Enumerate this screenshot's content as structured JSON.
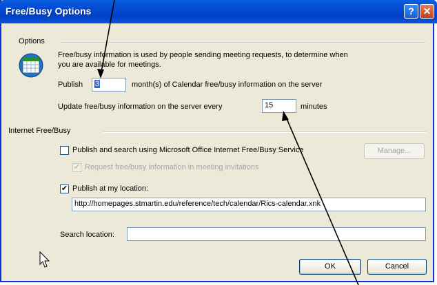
{
  "window": {
    "title": "Free/Busy Options",
    "help_glyph": "?",
    "close_glyph": "✕"
  },
  "options": {
    "group_label": "Options",
    "description_line1": "Free/busy information is used by people sending meeting requests, to determine when",
    "description_line2": "you are available for meetings.",
    "publish_label": "Publish",
    "publish_months_value": "3",
    "publish_suffix": "month(s) of Calendar free/busy information on the server",
    "update_label": "Update free/busy information on the server every",
    "update_minutes_value": "15",
    "update_suffix": "minutes"
  },
  "internet": {
    "group_label": "Internet Free/Busy",
    "ms_service_label": "Publish and search using Microsoft Office Internet Free/Busy Service",
    "ms_service_checked": false,
    "manage_button": "Manage...",
    "request_label": "Request free/busy information in meeting invitations",
    "request_checked": true,
    "publish_location_label": "Publish at my location:",
    "publish_location_checked": true,
    "publish_location_url": "http://homepages.stmartin.edu/reference/tech/calendar/Rics-calendar.xnk",
    "search_location_label": "Search location:",
    "search_location_value": ""
  },
  "buttons": {
    "ok": "OK",
    "cancel": "Cancel"
  },
  "icons": {
    "calendar": "calendar-icon",
    "check_mark": "✔",
    "cursor": "mouse-pointer-icon"
  },
  "colors": {
    "titlebar": "#0349d2",
    "dialog_bg": "#ece9d8",
    "selection": "#316ac5",
    "annotation_arrow": "#000000"
  }
}
